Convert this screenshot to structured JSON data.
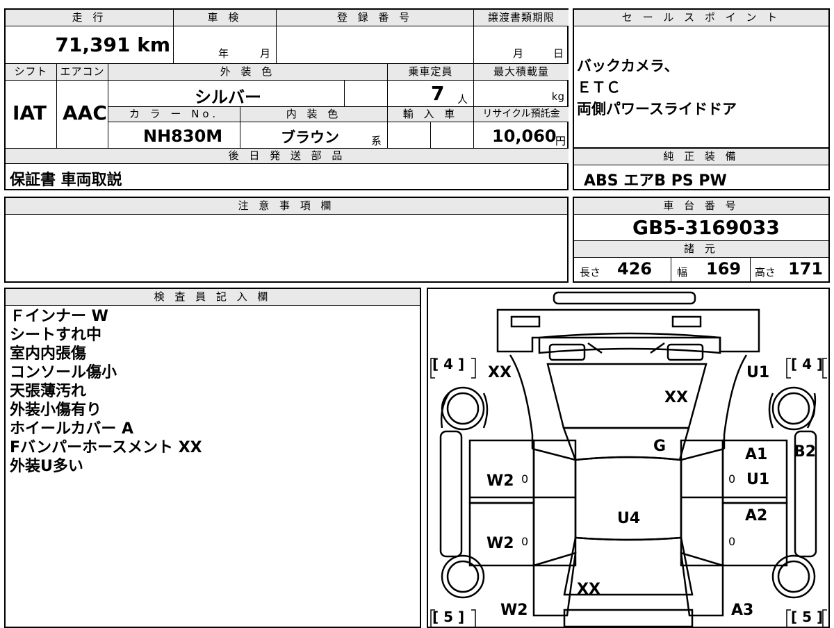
{
  "top_block": {
    "headers": {
      "mileage": "走 行",
      "shaken": "車 検",
      "reg_no": "登 録 番 号",
      "transfer_doc": "譲渡書類期限"
    },
    "mileage_value": "71,391 km",
    "shaken_year": "年",
    "shaken_month": "月",
    "transfer_month": "月",
    "transfer_day": "日",
    "headers2": {
      "shift": "シフト",
      "aircon": "エアコン",
      "ext_color": "外 装 色",
      "capacity": "乗車定員",
      "max_load": "最大積載量"
    },
    "shift_value": "IAT",
    "aircon_value": "AAC",
    "ext_color_value": "シルバー",
    "capacity_value": "7",
    "capacity_unit": "人",
    "max_load_unit": "kg",
    "headers3": {
      "color_no": "カ ラ ー No.",
      "int_color": "内 装 色",
      "import": "輸 入 車",
      "recycle": "リサイクル預託金"
    },
    "color_no_value": "NH830M",
    "int_color_value": "ブラウン",
    "int_color_suffix": "系",
    "recycle_value": "10,060",
    "recycle_unit": "円",
    "later_parts_header": "後 日 発 送 部 品",
    "later_parts_value": "保証書 車両取説"
  },
  "sales_point": {
    "header": "セ ー ル ス ポ イ ン ト",
    "lines": [
      "バックカメラ、",
      "ＥＴＣ",
      "両側パワースライドドア"
    ]
  },
  "genuine_equipment": {
    "header": "純 正 装 備",
    "value": "ABS エアB PS PW"
  },
  "caution": {
    "header": "注 意 事 項 欄"
  },
  "chassis": {
    "header": "車 台 番 号",
    "value": "GB5-3169033"
  },
  "specs": {
    "header": "諸 元",
    "length_label": "長さ",
    "length_value": "426",
    "width_label": "幅",
    "width_value": "169",
    "height_label": "高さ",
    "height_value": "171"
  },
  "inspector": {
    "header": "検 査 員 記 入 欄",
    "notes": [
      "Ｆインナー W",
      "シートすれ中",
      "室内内張傷",
      "コンソール傷小",
      "天張薄汚れ",
      "外装小傷有り",
      "ホイールカバー A",
      "Fバンパーホースメント XX",
      "外装U多い"
    ]
  },
  "diagram": {
    "tire_fl": "[ 4 ]",
    "tire_fr": "[ 4 ]",
    "tire_rl": "[ 5 ]",
    "tire_rr": "[ 5 ]",
    "marks": {
      "front_left": "XX",
      "hood": "XX",
      "front_right": "U1",
      "windshield": "G",
      "a_pillar_right": "A1",
      "fender_right_b": "B2",
      "door_fr": "U1",
      "door_fl": "W2",
      "roof": "U4",
      "pillar_rr": "A2",
      "door_rl": "W2",
      "rear_left": "W2",
      "rear_glass": "XX",
      "rear_right": "A3"
    },
    "zero": "0"
  }
}
